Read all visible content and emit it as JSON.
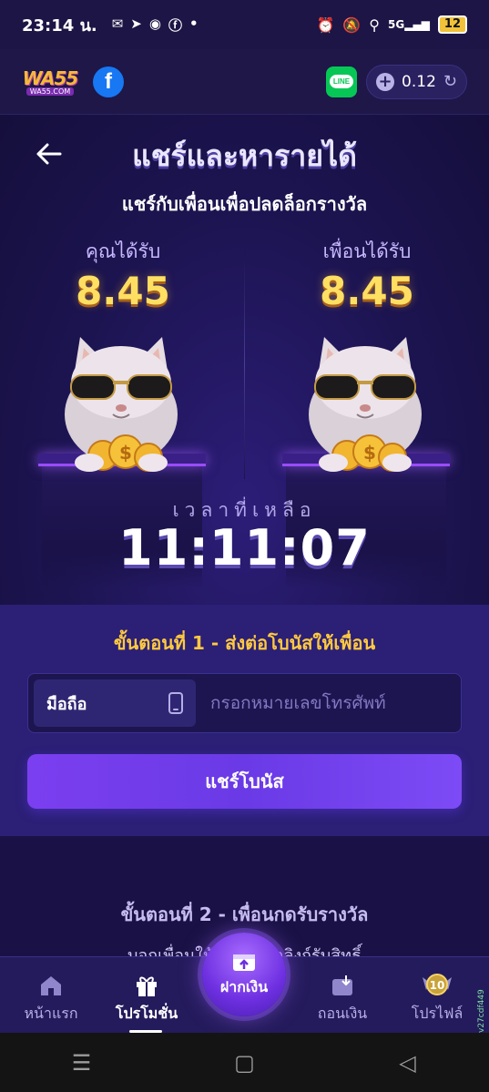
{
  "status_bar": {
    "time": "23:14 น.",
    "network": "5G",
    "battery": "12"
  },
  "header": {
    "logo_text": "WA55",
    "logo_sub": "WA55.COM",
    "balance": "0.12",
    "line_label": "LINE"
  },
  "hero": {
    "title": "แชร์และหารายได้",
    "subtitle": "แชร์กับเพื่อนเพื่อปลดล็อกรางวัล",
    "you_receive_label": "คุณได้รับ",
    "you_receive_value": "8.45",
    "friend_receive_label": "เพื่อนได้รับ",
    "friend_receive_value": "8.45",
    "time_left_label": "เวลาที่เหลือ",
    "time_left_value": "11:11:07"
  },
  "step1": {
    "title": "ขั้นตอนที่ 1 - ส่งต่อโบนัสให้เพื่อน",
    "phone_type": "มือถือ",
    "phone_placeholder": "กรอกหมายเลขโทรศัพท์",
    "phone_value": "",
    "share_button": "แชร์โบนัส"
  },
  "step2": {
    "title": "ขั้นตอนที่ 2 - เพื่อนกดรับรางวัล",
    "desc": "บอกเพื่อนให้โปรดคลิกลิงก์รับสิทธิ์"
  },
  "bottom_nav": {
    "home": "หน้าแรก",
    "promotions": "โปรโมชั่น",
    "deposit": "ฝากเงิน",
    "withdraw": "ถอนเงิน",
    "profile": "โปรไฟล์",
    "profile_badge": "10",
    "version": "v27cdf449"
  },
  "colors": {
    "background": "#1a1240",
    "accent": "#7b3ff0",
    "gold": "#ffdf62",
    "step_title": "#ffc940"
  }
}
